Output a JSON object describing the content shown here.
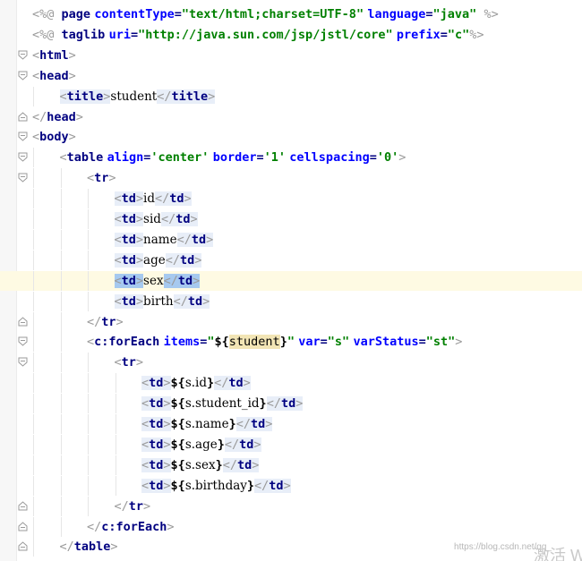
{
  "editor": {
    "lines": [
      {
        "fold": "none",
        "current": false,
        "tokens": [
          {
            "c": "brk",
            "t": "<%@ "
          },
          {
            "c": "tag",
            "t": "page"
          },
          {
            "c": "txt",
            "t": " "
          },
          {
            "c": "attr",
            "t": "contentType"
          },
          {
            "c": "tag",
            "t": "="
          },
          {
            "c": "str",
            "t": "\"text/html;charset=UTF-8\""
          },
          {
            "c": "txt",
            "t": " "
          },
          {
            "c": "attr",
            "t": "language"
          },
          {
            "c": "tag",
            "t": "="
          },
          {
            "c": "str",
            "t": "\"java\""
          },
          {
            "c": "brk",
            "t": " %>"
          }
        ]
      },
      {
        "fold": "none",
        "current": false,
        "tokens": [
          {
            "c": "brk",
            "t": "<%@ "
          },
          {
            "c": "tag",
            "t": "taglib"
          },
          {
            "c": "txt",
            "t": " "
          },
          {
            "c": "attr",
            "t": "uri"
          },
          {
            "c": "tag",
            "t": "="
          },
          {
            "c": "str",
            "t": "\"http://java.sun.com/jsp/jstl/core\""
          },
          {
            "c": "txt",
            "t": " "
          },
          {
            "c": "attr",
            "t": "prefix"
          },
          {
            "c": "tag",
            "t": "="
          },
          {
            "c": "str",
            "t": "\"c\""
          },
          {
            "c": "brk",
            "t": "%>"
          }
        ]
      },
      {
        "fold": "open",
        "current": false,
        "tokens": [
          {
            "c": "brk",
            "t": "<"
          },
          {
            "c": "tag",
            "t": "html"
          },
          {
            "c": "brk",
            "t": ">"
          }
        ]
      },
      {
        "fold": "open",
        "current": false,
        "tokens": [
          {
            "c": "brk",
            "t": "<"
          },
          {
            "c": "tag",
            "t": "head"
          },
          {
            "c": "brk",
            "t": ">"
          }
        ]
      },
      {
        "fold": "none",
        "current": false,
        "tokens": [
          {
            "c": "brk",
            "t": "<"
          },
          {
            "c": "tag",
            "t": "title"
          },
          {
            "c": "brk",
            "t": ">"
          },
          {
            "c": "txt",
            "t": "student"
          },
          {
            "c": "brk",
            "t": "</"
          },
          {
            "c": "tag",
            "t": "title"
          },
          {
            "c": "brk",
            "t": ">"
          }
        ]
      },
      {
        "fold": "close",
        "current": false,
        "tokens": [
          {
            "c": "brk",
            "t": "</"
          },
          {
            "c": "tag",
            "t": "head"
          },
          {
            "c": "brk",
            "t": ">"
          }
        ]
      },
      {
        "fold": "open",
        "current": false,
        "tokens": [
          {
            "c": "brk",
            "t": "<"
          },
          {
            "c": "tag",
            "t": "body"
          },
          {
            "c": "brk",
            "t": ">"
          }
        ]
      },
      {
        "fold": "open",
        "current": false,
        "tokens": [
          {
            "c": "brk",
            "t": "<"
          },
          {
            "c": "tag",
            "t": "table"
          },
          {
            "c": "txt",
            "t": " "
          },
          {
            "c": "attr",
            "t": "align"
          },
          {
            "c": "tag",
            "t": "="
          },
          {
            "c": "str",
            "t": "'center'"
          },
          {
            "c": "txt",
            "t": " "
          },
          {
            "c": "attr",
            "t": "border"
          },
          {
            "c": "tag",
            "t": "="
          },
          {
            "c": "str",
            "t": "'1'"
          },
          {
            "c": "txt",
            "t": " "
          },
          {
            "c": "attr",
            "t": "cellspacing"
          },
          {
            "c": "tag",
            "t": "="
          },
          {
            "c": "str",
            "t": "'0'"
          },
          {
            "c": "brk",
            "t": ">"
          }
        ]
      },
      {
        "fold": "open",
        "current": false,
        "tokens": [
          {
            "c": "brk",
            "t": "<"
          },
          {
            "c": "tag",
            "t": "tr"
          },
          {
            "c": "brk",
            "t": ">"
          }
        ]
      },
      {
        "fold": "none",
        "current": false,
        "tokens": [
          {
            "c": "brk",
            "t": "<"
          },
          {
            "c": "tag",
            "t": "td"
          },
          {
            "c": "brk",
            "t": ">"
          },
          {
            "c": "txt",
            "t": "id"
          },
          {
            "c": "brk",
            "t": "</"
          },
          {
            "c": "tag",
            "t": "td"
          },
          {
            "c": "brk",
            "t": ">"
          }
        ]
      },
      {
        "fold": "none",
        "current": false,
        "tokens": [
          {
            "c": "brk",
            "t": "<"
          },
          {
            "c": "tag",
            "t": "td"
          },
          {
            "c": "brk",
            "t": ">"
          },
          {
            "c": "txt",
            "t": "sid"
          },
          {
            "c": "brk",
            "t": "</"
          },
          {
            "c": "tag",
            "t": "td"
          },
          {
            "c": "brk",
            "t": ">"
          }
        ]
      },
      {
        "fold": "none",
        "current": false,
        "tokens": [
          {
            "c": "brk",
            "t": "<"
          },
          {
            "c": "tag",
            "t": "td"
          },
          {
            "c": "brk",
            "t": ">"
          },
          {
            "c": "txt",
            "t": "name"
          },
          {
            "c": "brk",
            "t": "</"
          },
          {
            "c": "tag",
            "t": "td"
          },
          {
            "c": "brk",
            "t": ">"
          }
        ]
      },
      {
        "fold": "none",
        "current": false,
        "tokens": [
          {
            "c": "brk",
            "t": "<"
          },
          {
            "c": "tag",
            "t": "td"
          },
          {
            "c": "brk",
            "t": ">"
          },
          {
            "c": "txt",
            "t": "age"
          },
          {
            "c": "brk",
            "t": "</"
          },
          {
            "c": "tag",
            "t": "td"
          },
          {
            "c": "brk",
            "t": ">"
          }
        ]
      },
      {
        "fold": "none",
        "current": true,
        "selected": true,
        "tokens": [
          {
            "c": "brk",
            "t": "<"
          },
          {
            "c": "tag",
            "t": "td"
          },
          {
            "c": "brk",
            "t": ">"
          },
          {
            "c": "txt",
            "t": "sex"
          },
          {
            "c": "brk",
            "t": "</"
          },
          {
            "c": "tag",
            "t": "td"
          },
          {
            "c": "brk",
            "t": ">"
          }
        ]
      },
      {
        "fold": "none",
        "current": false,
        "tokens": [
          {
            "c": "brk",
            "t": "<"
          },
          {
            "c": "tag",
            "t": "td"
          },
          {
            "c": "brk",
            "t": ">"
          },
          {
            "c": "txt",
            "t": "birth"
          },
          {
            "c": "brk",
            "t": "</"
          },
          {
            "c": "tag",
            "t": "td"
          },
          {
            "c": "brk",
            "t": ">"
          }
        ]
      },
      {
        "fold": "close",
        "current": false,
        "tokens": [
          {
            "c": "brk",
            "t": "</"
          },
          {
            "c": "tag",
            "t": "tr"
          },
          {
            "c": "brk",
            "t": ">"
          }
        ]
      },
      {
        "fold": "open",
        "current": false,
        "tokens": [
          {
            "c": "brk",
            "t": "<"
          },
          {
            "c": "tag",
            "t": "c:forEach"
          },
          {
            "c": "txt",
            "t": " "
          },
          {
            "c": "attr",
            "t": "items"
          },
          {
            "c": "tag",
            "t": "="
          },
          {
            "c": "str",
            "t": "\""
          },
          {
            "c": "el",
            "t": "${"
          },
          {
            "c": "hl-var",
            "t": "student"
          },
          {
            "c": "el",
            "t": "}"
          },
          {
            "c": "str",
            "t": "\""
          },
          {
            "c": "txt",
            "t": " "
          },
          {
            "c": "attr",
            "t": "var"
          },
          {
            "c": "tag",
            "t": "="
          },
          {
            "c": "str",
            "t": "\"s\""
          },
          {
            "c": "txt",
            "t": " "
          },
          {
            "c": "attr",
            "t": "varStatus"
          },
          {
            "c": "tag",
            "t": "="
          },
          {
            "c": "str",
            "t": "\"st\""
          },
          {
            "c": "brk",
            "t": ">"
          }
        ]
      },
      {
        "fold": "open",
        "current": false,
        "tokens": [
          {
            "c": "brk",
            "t": "<"
          },
          {
            "c": "tag",
            "t": "tr"
          },
          {
            "c": "brk",
            "t": ">"
          }
        ]
      },
      {
        "fold": "none",
        "current": false,
        "tokens": [
          {
            "c": "brk",
            "t": "<"
          },
          {
            "c": "tag",
            "t": "td"
          },
          {
            "c": "brk",
            "t": ">"
          },
          {
            "c": "el",
            "t": "${"
          },
          {
            "c": "elv",
            "t": "s.id"
          },
          {
            "c": "el",
            "t": "}"
          },
          {
            "c": "brk",
            "t": "</"
          },
          {
            "c": "tag",
            "t": "td"
          },
          {
            "c": "brk",
            "t": ">"
          }
        ]
      },
      {
        "fold": "none",
        "current": false,
        "tokens": [
          {
            "c": "brk",
            "t": "<"
          },
          {
            "c": "tag",
            "t": "td"
          },
          {
            "c": "brk",
            "t": ">"
          },
          {
            "c": "el",
            "t": "${"
          },
          {
            "c": "elv",
            "t": "s.student_id"
          },
          {
            "c": "el",
            "t": "}"
          },
          {
            "c": "brk",
            "t": "</"
          },
          {
            "c": "tag",
            "t": "td"
          },
          {
            "c": "brk",
            "t": ">"
          }
        ]
      },
      {
        "fold": "none",
        "current": false,
        "tokens": [
          {
            "c": "brk",
            "t": "<"
          },
          {
            "c": "tag",
            "t": "td"
          },
          {
            "c": "brk",
            "t": ">"
          },
          {
            "c": "el",
            "t": "${"
          },
          {
            "c": "elv",
            "t": "s.name"
          },
          {
            "c": "el",
            "t": "}"
          },
          {
            "c": "brk",
            "t": "</"
          },
          {
            "c": "tag",
            "t": "td"
          },
          {
            "c": "brk",
            "t": ">"
          }
        ]
      },
      {
        "fold": "none",
        "current": false,
        "tokens": [
          {
            "c": "brk",
            "t": "<"
          },
          {
            "c": "tag",
            "t": "td"
          },
          {
            "c": "brk",
            "t": ">"
          },
          {
            "c": "el",
            "t": "${"
          },
          {
            "c": "elv",
            "t": "s.age"
          },
          {
            "c": "el",
            "t": "}"
          },
          {
            "c": "brk",
            "t": "</"
          },
          {
            "c": "tag",
            "t": "td"
          },
          {
            "c": "brk",
            "t": ">"
          }
        ]
      },
      {
        "fold": "none",
        "current": false,
        "tokens": [
          {
            "c": "brk",
            "t": "<"
          },
          {
            "c": "tag",
            "t": "td"
          },
          {
            "c": "brk",
            "t": ">"
          },
          {
            "c": "el",
            "t": "${"
          },
          {
            "c": "elv",
            "t": "s.sex"
          },
          {
            "c": "el",
            "t": "}"
          },
          {
            "c": "brk",
            "t": "</"
          },
          {
            "c": "tag",
            "t": "td"
          },
          {
            "c": "brk",
            "t": ">"
          }
        ]
      },
      {
        "fold": "none",
        "current": false,
        "tokens": [
          {
            "c": "brk",
            "t": "<"
          },
          {
            "c": "tag",
            "t": "td"
          },
          {
            "c": "brk",
            "t": ">"
          },
          {
            "c": "el",
            "t": "${"
          },
          {
            "c": "elv",
            "t": "s.birthday"
          },
          {
            "c": "el",
            "t": "}"
          },
          {
            "c": "brk",
            "t": "</"
          },
          {
            "c": "tag",
            "t": "td"
          },
          {
            "c": "brk",
            "t": ">"
          }
        ]
      },
      {
        "fold": "close",
        "current": false,
        "tokens": [
          {
            "c": "brk",
            "t": "</"
          },
          {
            "c": "tag",
            "t": "tr"
          },
          {
            "c": "brk",
            "t": ">"
          }
        ]
      },
      {
        "fold": "close",
        "current": false,
        "tokens": [
          {
            "c": "brk",
            "t": "</"
          },
          {
            "c": "tag",
            "t": "c:forEach"
          },
          {
            "c": "brk",
            "t": ">"
          }
        ]
      },
      {
        "fold": "close",
        "current": false,
        "tokens": [
          {
            "c": "brk",
            "t": "</"
          },
          {
            "c": "tag",
            "t": "table"
          },
          {
            "c": "brk",
            "t": ">"
          }
        ]
      }
    ]
  },
  "watermark": "https://blog.csdn.net/qq_",
  "activate_text": "激活 W"
}
